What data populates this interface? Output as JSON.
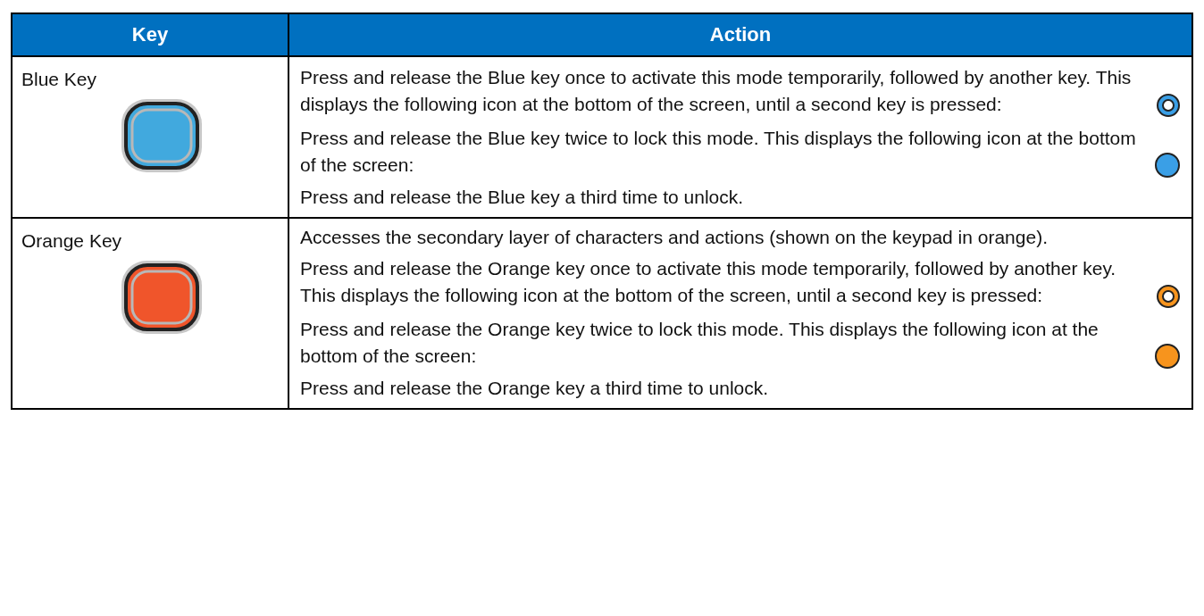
{
  "table": {
    "columns": [
      "Key",
      "Action"
    ],
    "rows": [
      {
        "key": "Blue Key",
        "color": "#41a9de",
        "paragraphs": [
          {
            "text": "Press and release the Blue key once to activate this mode temporarily, followed by another key. This displays the following icon at the bottom of the screen, until a second key is pressed:",
            "kind": "ring",
            "color": "#3a9fe6"
          },
          {
            "text": "Press and release the Blue key twice to lock this mode. This displays the following icon at the bottom of the screen:",
            "kind": "dot",
            "color": "#3a9fe6"
          },
          {
            "text": "Press and release the Blue key a third time to unlock.",
            "kind": "plain"
          }
        ]
      },
      {
        "key": "Orange Key",
        "color": "#f0552b",
        "paragraphs": [
          {
            "text": "Accesses the secondary layer of characters and actions (shown on the keypad in orange).",
            "kind": "plain"
          },
          {
            "text": "Press and release the Orange key once to activate this mode temporarily, followed by another key. This displays the following icon at the bottom of the screen, until a second key is pressed:",
            "kind": "ring",
            "color": "#f7941d"
          },
          {
            "text": "Press and release the Orange key twice to lock this mode. This displays the following icon at the bottom of the screen:",
            "kind": "dot",
            "color": "#f7941d"
          },
          {
            "text": "Press and release the Orange key a third time to unlock.",
            "kind": "plain"
          }
        ]
      }
    ]
  }
}
